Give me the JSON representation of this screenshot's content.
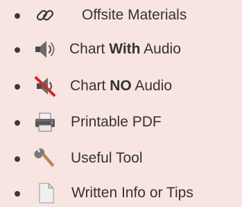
{
  "legend": {
    "items": [
      {
        "icon": "chain-link-icon",
        "text": "Offsite Materials"
      },
      {
        "icon": "speaker-icon",
        "text_before": "Chart ",
        "text_bold": "With",
        "text_after": " Audio"
      },
      {
        "icon": "speaker-muted-icon",
        "text_before": "Chart ",
        "text_bold": "NO",
        "text_after": " Audio"
      },
      {
        "icon": "printer-icon",
        "text": "Printable PDF"
      },
      {
        "icon": "wrench-icon",
        "text": "Useful Tool"
      },
      {
        "icon": "document-icon",
        "text": "Written Info or Tips"
      }
    ]
  },
  "colors": {
    "background": "#f8e4e0",
    "text": "#333333",
    "mute_slash": "#d2282a"
  }
}
